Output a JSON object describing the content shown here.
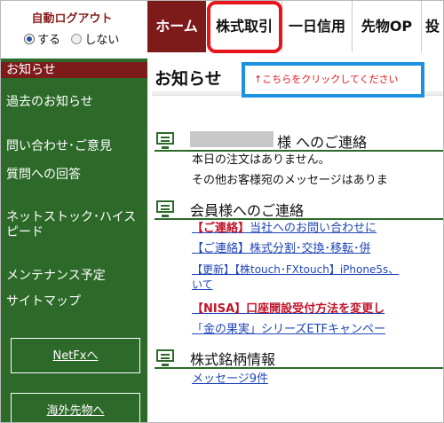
{
  "autologout": {
    "title": "自動ログアウト",
    "on_label": "する",
    "off_label": "しない"
  },
  "nav": {
    "home": "ホーム",
    "stock": "株式取引",
    "oneday": "一日信用",
    "futures": "先物OP",
    "more": "投"
  },
  "sidebar": {
    "items": [
      "お知らせ",
      "過去のお知らせ",
      "問い合わせ･ご意見",
      "質問への回答",
      "ネットストック･ハイス",
      "ピード",
      "メンテナンス予定",
      "サイトマップ"
    ],
    "netfx_button": "NetFxへ",
    "overseas_button": "海外先物へ"
  },
  "main": {
    "title": "お知らせ",
    "click_note": "↑こちらをクリックしてください",
    "section1": {
      "title": "様 へのご連絡",
      "items": [
        "本日の注文はありません。",
        "その他お客様宛のメッセージはありま"
      ]
    },
    "section2": {
      "title": "会員様へのご連絡",
      "items": [
        {
          "tag": "【ご連絡】",
          "text": "当社へのお問い合わせに"
        },
        {
          "tag": "",
          "text": "【ご連絡】株式分割･交換･移転･併"
        },
        {
          "tag": "",
          "text": "【更新】【株touch･FXtouch】iPhone5s、"
        },
        {
          "tag": "",
          "text": "いて"
        },
        {
          "tag": "【NISA】",
          "text": "口座開設受付方法を変更し"
        },
        {
          "tag": "",
          "text": "「金の果実」シリーズETFキャンペー"
        }
      ]
    },
    "section3": {
      "title": "株式銘柄情報",
      "items": [
        "メッセージ9件"
      ]
    }
  },
  "colors": {
    "brand_red": "#7d1a1a",
    "sidebar_green": "#2d6a2a",
    "annotation_red": "#e8141b",
    "annotation_blue": "#1e90e0",
    "link_blue": "#2046b8"
  }
}
